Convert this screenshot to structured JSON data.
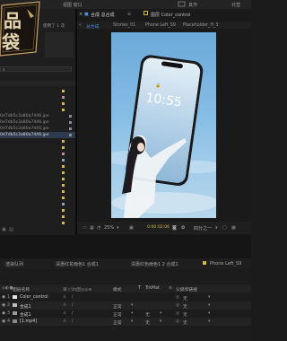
{
  "menu": {
    "window_title_fragment": "视图  窗口",
    "item_right1": "其作",
    "item_right2": "日营"
  },
  "project": {
    "label_right": "使用了 1 次",
    "files": [
      "0d7db5c3a80a7446.jpe",
      "0d7db5c3a80a7446.jpe",
      "0d7db5c3a80a7446.jpe",
      "0d7db5c3a80a7446.jpe"
    ]
  },
  "comp": {
    "panel_title": "合成 总合成",
    "layer_panel_title": "图层  Color_control",
    "tabs": [
      "总合成",
      "Stories_01",
      "Phone Left_S9",
      "Placeholder_H_3"
    ],
    "phone_time": "10:55"
  },
  "viewer": {
    "zoom": "25%",
    "timecode": "0:00:02:06",
    "view_mode": "四分之一"
  },
  "timeline": {
    "tabs": [
      "渲染队列",
      "清惠红花雨色1 合成1",
      "清惠红色雨色1 2 合成1",
      "Phone Left_S9"
    ],
    "header": {
      "layer_name": "图层名称",
      "switches": "单☆\\fx图◎◎⊕",
      "mode": "模式",
      "t": "T",
      "trkmat": "TrkMat",
      "parent": "父级和链接"
    },
    "layers": [
      {
        "num": "1",
        "name": "Color_control",
        "color": "#d9d9d9",
        "mode": "",
        "trk": "",
        "parent": "无"
      },
      {
        "num": "2",
        "name": "合成1",
        "color": "#a0a0a0",
        "mode": "正常",
        "trk": "",
        "parent": "无"
      },
      {
        "num": "3",
        "name": "合成1",
        "color": "#9a9a9a",
        "mode": "正常",
        "trk": "无",
        "parent": "无"
      },
      {
        "num": "4",
        "name": "[1.mp4]",
        "color": "#8f8f8f",
        "mode": "正常",
        "trk": "无",
        "parent": "无"
      }
    ]
  },
  "colors": {
    "accent_blue": "#4a8bdc",
    "label_yellow": "#d6b84a",
    "label_pink": "#c08a9a"
  }
}
